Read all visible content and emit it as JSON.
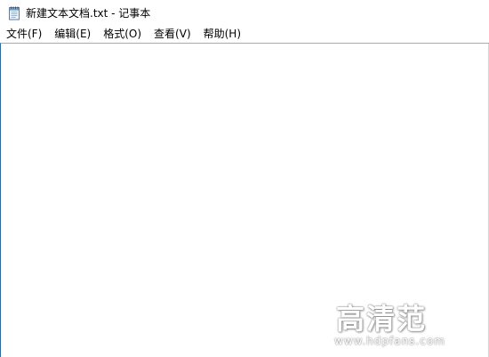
{
  "window": {
    "title": "新建文本文档.txt - 记事本",
    "icon": "notepad-icon"
  },
  "menubar": {
    "items": [
      {
        "label": "文件(F)"
      },
      {
        "label": "编辑(E)"
      },
      {
        "label": "格式(O)"
      },
      {
        "label": "查看(V)"
      },
      {
        "label": "帮助(H)"
      }
    ]
  },
  "editor": {
    "content": ""
  },
  "watermark": {
    "logo": "高清范",
    "url": "www.hdpfans.com"
  },
  "colors": {
    "focus_border": "#0078d7",
    "background": "#ffffff"
  }
}
